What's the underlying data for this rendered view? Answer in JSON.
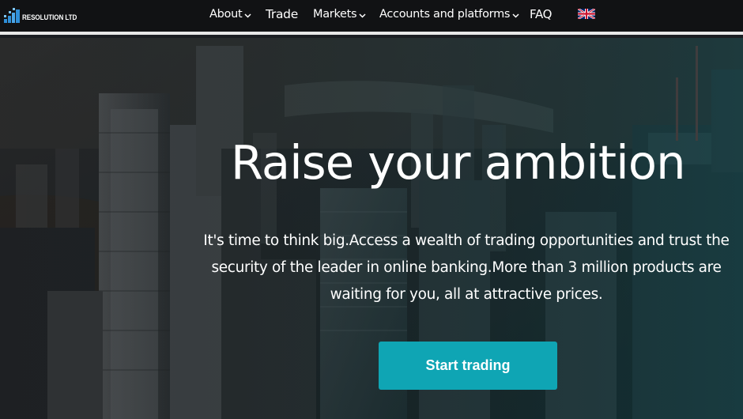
{
  "brand": {
    "name": "RESOLUTION LTD"
  },
  "nav": {
    "items": [
      {
        "label": "About",
        "has_dropdown": true
      },
      {
        "label": "Trade",
        "has_dropdown": false
      },
      {
        "label": "Markets",
        "has_dropdown": true
      },
      {
        "label": "Accounts and platforms",
        "has_dropdown": true
      },
      {
        "label": "FAQ",
        "has_dropdown": false
      }
    ],
    "language_icon": "uk-flag-icon"
  },
  "hero": {
    "title": "Raise your ambition",
    "description": "It's time to think big.Access a wealth of trading opportunities and trust the security of the leader in online banking.More than 3 million products are waiting for you, all at attractive prices.",
    "cta_label": "Start trading",
    "background": "city-skyline-aerial-photo"
  },
  "colors": {
    "navbar": "#111214",
    "accent": "#0fa5b4",
    "logo_blue": "#2f8fd8",
    "text": "#ffffff"
  }
}
